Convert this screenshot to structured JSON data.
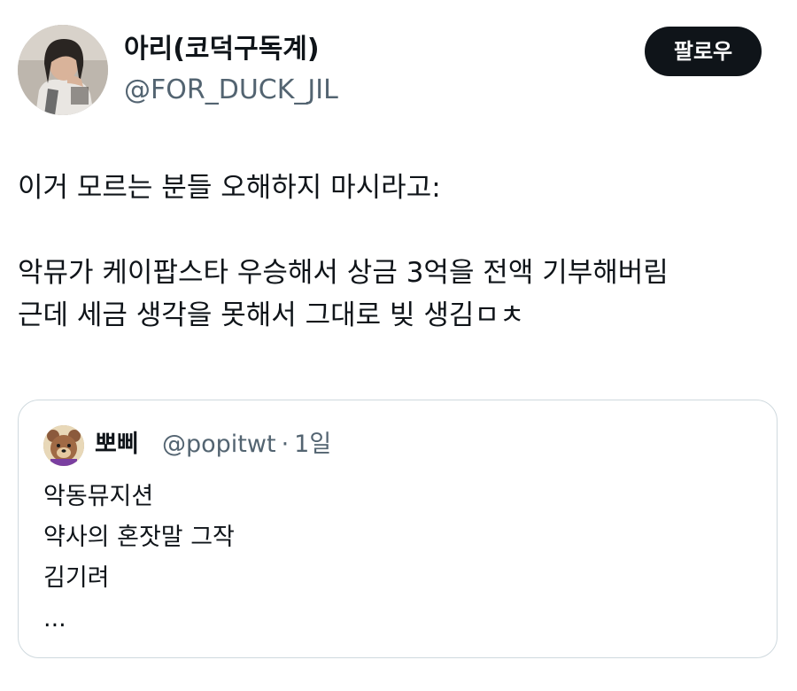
{
  "author": {
    "display_name": "아리(코덕구독계)",
    "handle": "@FOR_DUCK_JIL",
    "avatar_icon": "profile-photo"
  },
  "follow_button": {
    "label": "팔로우",
    "bg_color": "#0f1419",
    "text_color": "#ffffff"
  },
  "tweet": {
    "lines": [
      "이거 모르는 분들 오해하지 마시라고:",
      "악뮤가 케이팝스타 우승해서 상금 3억을 전액 기부해버림",
      "근데 세금 생각을 못해서 그대로 빚 생김ㅁㅊ"
    ]
  },
  "quote": {
    "avatar_icon": "bear-character-avatar",
    "display_name": "뽀삐",
    "handle": "@popitwt",
    "separator": "·",
    "time": "1일",
    "lines": [
      "악동뮤지션",
      "약사의 혼잣말 그작",
      "김기려",
      "..."
    ]
  },
  "colors": {
    "text_primary": "#0f1419",
    "text_secondary": "#536471",
    "border": "#cfd9de"
  }
}
